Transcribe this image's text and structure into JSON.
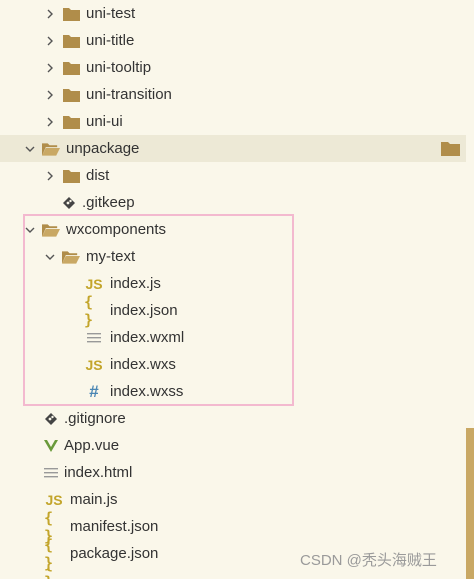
{
  "explorer": {
    "items": [
      {
        "label": "uni-test",
        "kind": "folder",
        "expanded": false
      },
      {
        "label": "uni-title",
        "kind": "folder",
        "expanded": false
      },
      {
        "label": "uni-tooltip",
        "kind": "folder",
        "expanded": false
      },
      {
        "label": "uni-transition",
        "kind": "folder",
        "expanded": false
      },
      {
        "label": "uni-ui",
        "kind": "folder",
        "expanded": false
      },
      {
        "label": "unpackage",
        "kind": "folder-open",
        "expanded": true,
        "selected": true
      },
      {
        "label": "dist",
        "kind": "folder",
        "expanded": false
      },
      {
        "label": ".gitkeep",
        "kind": "git-file"
      },
      {
        "label": "wxcomponents",
        "kind": "folder-open",
        "expanded": true
      },
      {
        "label": "my-text",
        "kind": "folder-open",
        "expanded": true
      },
      {
        "label": "index.js",
        "kind": "js-file"
      },
      {
        "label": "index.json",
        "kind": "json-file"
      },
      {
        "label": "index.wxml",
        "kind": "text-file"
      },
      {
        "label": "index.wxs",
        "kind": "js-file"
      },
      {
        "label": "index.wxss",
        "kind": "css-file"
      },
      {
        "label": ".gitignore",
        "kind": "git-file"
      },
      {
        "label": "App.vue",
        "kind": "vue-file"
      },
      {
        "label": "index.html",
        "kind": "text-file"
      },
      {
        "label": "main.js",
        "kind": "js-file"
      },
      {
        "label": "manifest.json",
        "kind": "json-file"
      },
      {
        "label": "package.json",
        "kind": "json-file"
      }
    ],
    "icon_glyphs": {
      "js": "JS",
      "json": "{ }",
      "css": "#"
    }
  },
  "watermark": {
    "text": "CSDN @秃头海贼王"
  },
  "colors": {
    "background": "#faf7ea",
    "selected_row": "#ede9d6",
    "folder": "#b08d4a",
    "js_icon": "#c3a52b",
    "css_icon": "#4a86b4",
    "vue_icon": "#6a9a3a",
    "highlight_border": "#f3b9cf",
    "scrollbar": "#c9a864"
  }
}
